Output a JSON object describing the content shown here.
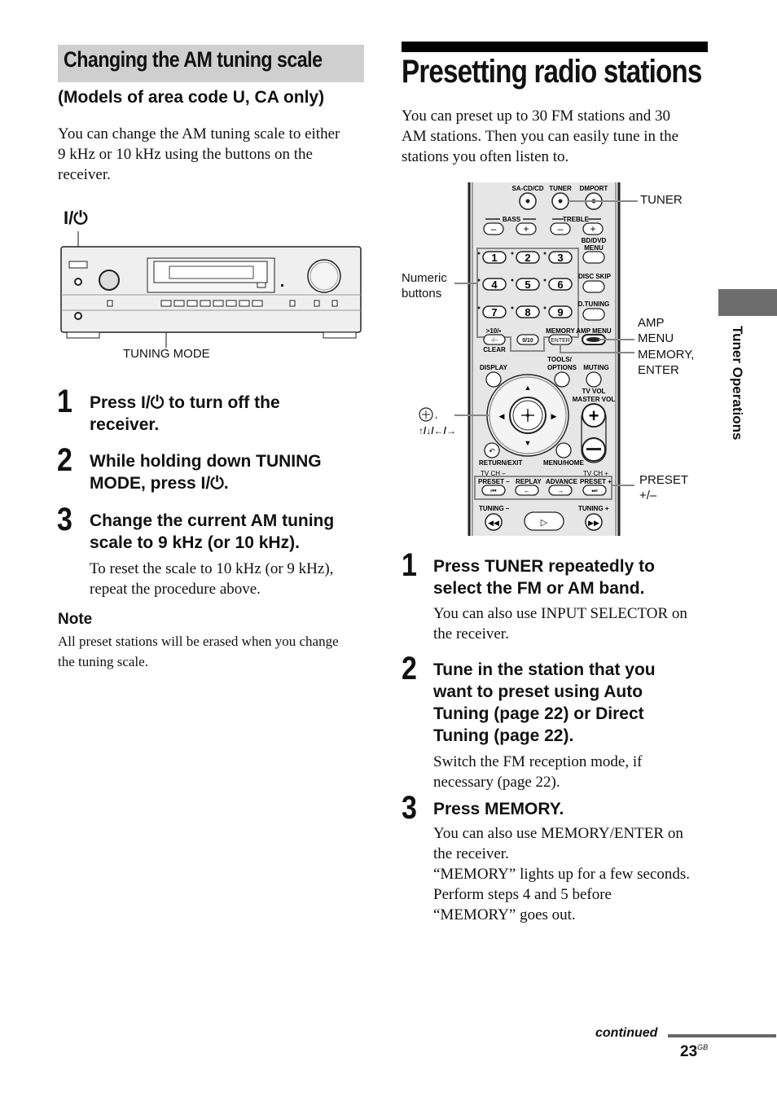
{
  "left_section": {
    "heading": "Changing the AM tuning scale",
    "subheading": "(Models of area code U, CA only)",
    "intro": [
      "You can change the AM tuning scale to either",
      "9 kHz or 10 kHz using the buttons on the",
      "receiver."
    ],
    "figure": {
      "power_label": "I/⏻",
      "tuning_mode_label": "TUNING MODE"
    },
    "steps": [
      {
        "number": "1",
        "heading_lines": [
          "Press I/⏻ to turn off the",
          "receiver."
        ]
      },
      {
        "number": "2",
        "heading_lines": [
          "While holding down TUNING",
          "MODE, press I/⏻."
        ]
      },
      {
        "number": "3",
        "heading_lines": [
          "Change the current AM tuning",
          "scale to 9 kHz (or 10 kHz)."
        ],
        "body_lines": [
          "To reset the scale to 10 kHz (or 9 kHz),",
          "repeat the procedure above."
        ]
      }
    ],
    "note": {
      "heading": "Note",
      "lines": [
        "All preset stations will be erased when you change",
        "the tuning scale."
      ]
    }
  },
  "right_section": {
    "heading": "Presetting radio stations",
    "intro": [
      "You can preset up to 30 FM stations and 30",
      "AM stations. Then you can easily tune in the",
      "stations you often listen to."
    ],
    "remote": {
      "callouts": {
        "tuner": "TUNER",
        "numeric": [
          "Numeric",
          "buttons"
        ],
        "amp_menu": [
          "AMP",
          "MENU"
        ],
        "memory_enter": [
          "MEMORY,",
          "ENTER"
        ],
        "arrows": "↑/↓/←/→",
        "preset": [
          "PRESET",
          "+/–"
        ]
      },
      "labels": {
        "sacd": "SA-CD/CD",
        "tuner": "TUNER",
        "dmport": "DMPORT",
        "bass": "BASS",
        "treble": "TREBLE",
        "bddvd": [
          "BD/DVD",
          "MENU"
        ],
        "disc_skip": "DISC SKIP",
        "d_tuning": "D.TUNING",
        "gt10": ">10/▪",
        "dash": "-/--",
        "clear": "CLEAR",
        "zero": "0/10",
        "memory": "MEMORY",
        "enter": "ENTER",
        "amp_menu": "AMP MENU",
        "display": "DISPLAY",
        "tools": [
          "TOOLS/",
          "OPTIONS"
        ],
        "muting": "MUTING",
        "tv_vol": [
          "TV VOL",
          "MASTER VOL"
        ],
        "return": "RETURN/EXIT",
        "menu_home": "MENU/HOME",
        "tv_ch_minus": "TV CH –",
        "tv_ch_plus": "TV CH +",
        "preset_minus": "PRESET –",
        "replay": "REPLAY",
        "advance": "ADVANCE",
        "preset_plus": "PRESET +",
        "tuning_minus": "TUNING –",
        "tuning_plus": "TUNING +",
        "digits": [
          "1",
          "2",
          "3",
          "4",
          "5",
          "6",
          "7",
          "8",
          "9"
        ]
      }
    },
    "steps": [
      {
        "number": "1",
        "heading_lines": [
          "Press TUNER repeatedly to",
          "select the FM or AM band."
        ],
        "body_lines": [
          "You can also use INPUT SELECTOR on",
          "the receiver."
        ]
      },
      {
        "number": "2",
        "heading_lines": [
          "Tune in the station that you",
          "want to preset using Auto",
          "Tuning (page 22) or Direct",
          "Tuning (page 22)."
        ],
        "body_lines": [
          "Switch the FM reception mode, if",
          "necessary (page 22)."
        ]
      },
      {
        "number": "3",
        "heading_lines": [
          "Press MEMORY."
        ],
        "body_lines": [
          "You can also use MEMORY/ENTER on",
          "the receiver.",
          "“MEMORY” lights up for a few seconds.",
          "Perform steps 4 and 5 before",
          "“MEMORY” goes out."
        ]
      }
    ]
  },
  "side_tab": {
    "label": "Tuner Operations"
  },
  "footer": {
    "continued": "continued",
    "page_number": "23",
    "page_suffix": "GB"
  }
}
